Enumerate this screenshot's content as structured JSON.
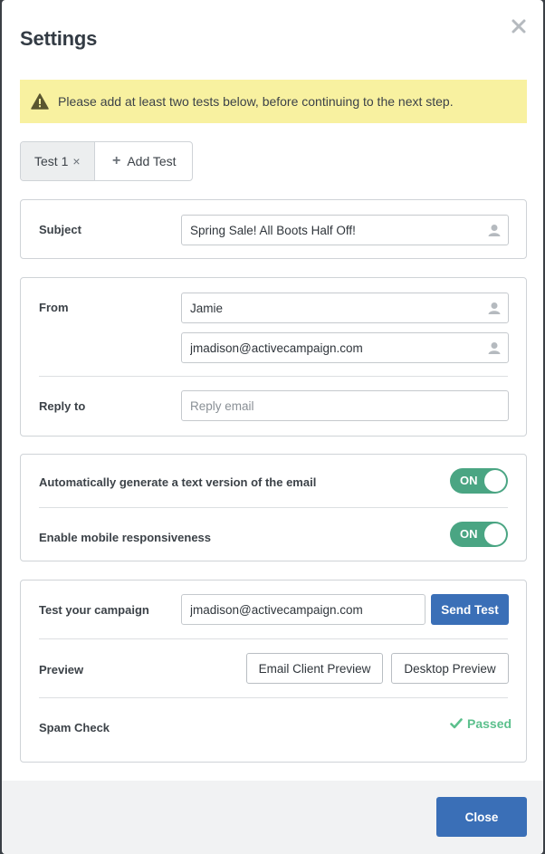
{
  "modal": {
    "title": "Settings",
    "close_icon": "close-icon"
  },
  "warning": {
    "icon": "warning-icon",
    "text": "Please add at least two tests below, before continuing to the next step."
  },
  "tabs": [
    {
      "label": "Test 1",
      "close_glyph": "×"
    },
    {
      "label": "Add Test",
      "icon_glyph": "+"
    }
  ],
  "subject": {
    "label": "Subject",
    "value": "Spring Sale! All Boots Half Off!"
  },
  "from": {
    "label": "From",
    "name_value": "Jamie",
    "email_value": "jmadison@activecampaign.com"
  },
  "reply_to": {
    "label": "Reply to",
    "placeholder": "Reply email"
  },
  "toggles": [
    {
      "label": "Automatically generate a text version of the email",
      "state": "ON"
    },
    {
      "label": "Enable mobile responsiveness",
      "state": "ON"
    }
  ],
  "test_campaign": {
    "label": "Test your campaign",
    "email_value": "jmadison@activecampaign.com",
    "send_label": "Send Test"
  },
  "preview": {
    "label": "Preview",
    "email_client_label": "Email Client Preview",
    "desktop_label": "Desktop Preview"
  },
  "spam_check": {
    "label": "Spam Check",
    "status": "Passed"
  },
  "footer": {
    "close_label": "Close"
  },
  "colors": {
    "warning_bg": "#f8f1a0",
    "toggle_on": "#4aa583",
    "primary": "#3a6fb7",
    "passed": "#5cc08d"
  }
}
